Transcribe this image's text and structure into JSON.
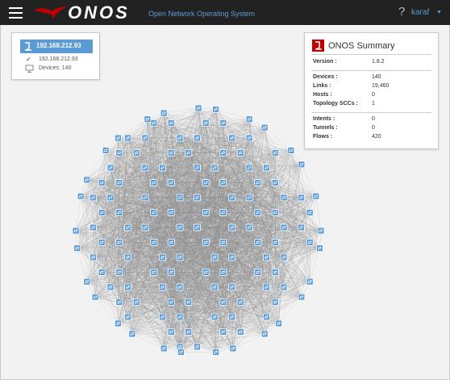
{
  "header": {
    "logo_text": "ONOS",
    "subtitle": "Open Network Operating System",
    "help_label": "?",
    "user_label": "karaf",
    "accent": "#5b9bd5"
  },
  "instance_panel": {
    "selected_ip": "192.168.212.93",
    "ip": "192.168.212.93",
    "devices_text": "Devices: 140"
  },
  "summary": {
    "title": "ONOS Summary",
    "groups": [
      [
        {
          "key": "Version :",
          "value": "1.8.2"
        }
      ],
      [
        {
          "key": "Devices :",
          "value": "140"
        },
        {
          "key": "Links :",
          "value": "19,460"
        },
        {
          "key": "Hosts :",
          "value": "0"
        },
        {
          "key": "Topology SCCs :",
          "value": "1"
        }
      ],
      [
        {
          "key": "Intents :",
          "value": "0"
        },
        {
          "key": "Tunnels :",
          "value": "0"
        },
        {
          "key": "Flows :",
          "value": "420"
        }
      ]
    ]
  },
  "topology": {
    "device_count": 140,
    "link_color": "#8a8a8a",
    "device_color": "#5b9bd5"
  }
}
